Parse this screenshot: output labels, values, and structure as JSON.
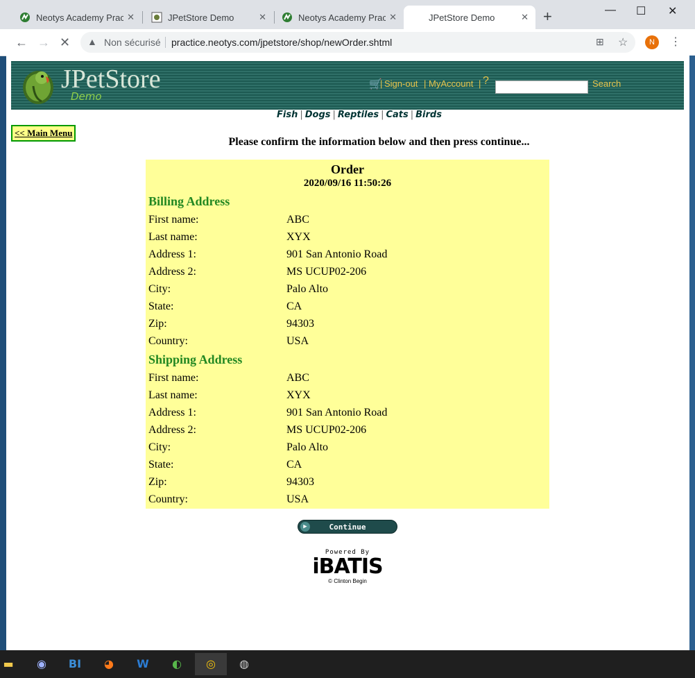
{
  "browser": {
    "tabs": [
      {
        "title": "Neotys Academy Practi",
        "icon": "neotys-icon",
        "active": false
      },
      {
        "title": "JPetStore Demo",
        "icon": "jpetstore-icon",
        "active": false
      },
      {
        "title": "Neotys Academy Practi",
        "icon": "neotys-icon",
        "active": false
      },
      {
        "title": "JPetStore Demo",
        "icon": "loading-icon",
        "active": true
      }
    ],
    "new_tab": "+",
    "window_controls": {
      "minimize": "—",
      "maximize": "☐",
      "close": "✕"
    },
    "security_label": "Non sécurisé",
    "url": "practice.neotys.com/jpetstore/shop/newOrder.shtml",
    "profile_initial": "N"
  },
  "store": {
    "logo_text": "JPetStore",
    "logo_sub": "Demo",
    "header_links": {
      "sign_out": "Sign-out",
      "my_account": "MyAccount",
      "help": "?",
      "search": "Search"
    },
    "categories": [
      "Fish",
      "Dogs",
      "Reptiles",
      "Cats",
      "Birds"
    ],
    "main_menu": "<< Main Menu",
    "instructions": "Please confirm the information below and then press continue...",
    "order": {
      "title": "Order",
      "date": "2020/09/16 11:50:26",
      "billing_heading": "Billing Address",
      "billing": [
        {
          "label": "First name:",
          "value": "ABC"
        },
        {
          "label": "Last name:",
          "value": "XYX"
        },
        {
          "label": "Address 1:",
          "value": "901 San Antonio Road"
        },
        {
          "label": "Address 2:",
          "value": "MS UCUP02-206"
        },
        {
          "label": "City:",
          "value": "Palo Alto"
        },
        {
          "label": "State:",
          "value": "CA"
        },
        {
          "label": "Zip:",
          "value": "94303"
        },
        {
          "label": "Country:",
          "value": "USA"
        }
      ],
      "shipping_heading": "Shipping Address",
      "shipping": [
        {
          "label": "First name:",
          "value": "ABC"
        },
        {
          "label": "Last name:",
          "value": "XYX"
        },
        {
          "label": "Address 1:",
          "value": "901 San Antonio Road"
        },
        {
          "label": "Address 2:",
          "value": "MS UCUP02-206"
        },
        {
          "label": "City:",
          "value": "Palo Alto"
        },
        {
          "label": "State:",
          "value": "CA"
        },
        {
          "label": "Zip:",
          "value": "94303"
        },
        {
          "label": "Country:",
          "value": "USA"
        }
      ]
    },
    "continue_label": "Continue",
    "powered_by": "Powered By",
    "ibatis_logo": "iBATIS",
    "ibatis_credit": "© Clinton Begin"
  },
  "taskbar": {
    "apps": [
      {
        "name": "file-explorer-icon",
        "glyph": "▬"
      },
      {
        "name": "discord-icon",
        "glyph": "◉"
      },
      {
        "name": "bi-icon",
        "glyph": "BI"
      },
      {
        "name": "firefox-icon",
        "glyph": "◕"
      },
      {
        "name": "word-icon",
        "glyph": "W"
      },
      {
        "name": "neoload-icon",
        "glyph": "◐"
      },
      {
        "name": "chrome-icon",
        "glyph": "◎"
      },
      {
        "name": "media-icon",
        "glyph": "◍"
      }
    ]
  },
  "colors": {
    "banner": "#1d5a52",
    "link": "#e6c34a",
    "panel": "#ffff99",
    "heading_green": "#228822"
  }
}
